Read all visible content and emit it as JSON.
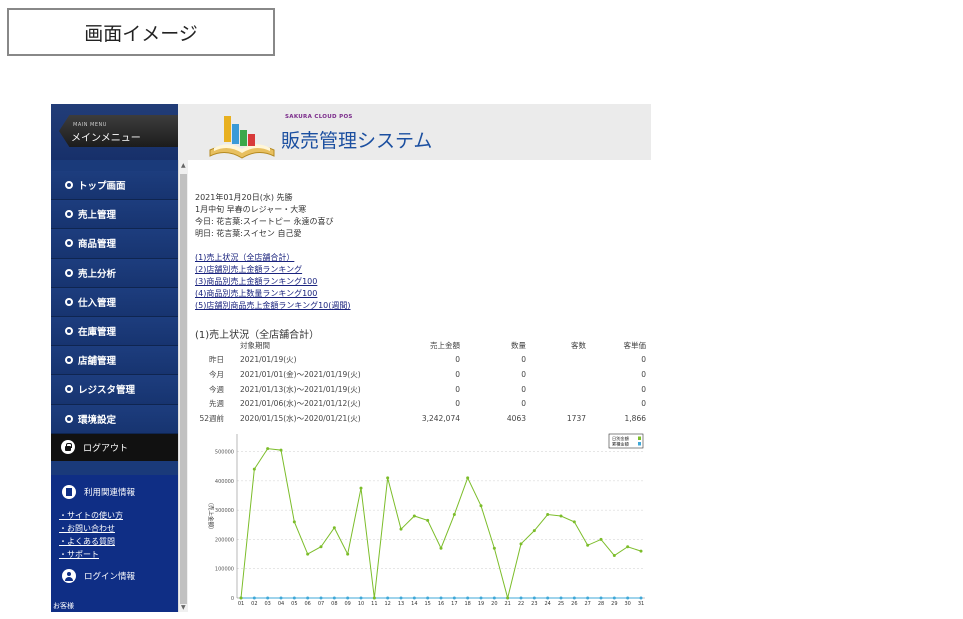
{
  "caption": "画面イメージ",
  "sidebar": {
    "mainmenu_small": "MAIN MENU",
    "mainmenu_title": "メインメニュー",
    "items": [
      "トップ画面",
      "売上管理",
      "商品管理",
      "売上分析",
      "仕入管理",
      "在庫管理",
      "店舗管理",
      "レジスタ管理",
      "環境設定"
    ],
    "logout": "ログアウト",
    "related_title": "利用関連情報",
    "related_links": [
      "サイトの使い方",
      "お問い合わせ",
      "よくある質問",
      "サポート"
    ],
    "login_title": "ログイン情報",
    "guest": "お客様"
  },
  "header": {
    "brand_small": "SAKURA CLOUD POS",
    "brand_title": "販売管理システム"
  },
  "info": {
    "date": "2021年01月20日(水) 先勝",
    "season": "1月中旬 早春のレジャー・大寒",
    "today_flower": "今日: 花言葉:スイートピー 永遠の喜び",
    "tomorrow_flower": "明日: 花言葉:スイセン 自己愛"
  },
  "links": [
    "(1)売上状況（全店舗合計）",
    "(2)店舗別売上金額ランキング",
    "(3)商品別売上金額ランキング100",
    "(4)商品別売上数量ランキング100",
    "(5)店舗別商品売上金額ランキング10(週間)"
  ],
  "section_title": "(1)売上状況（全店舗合計）",
  "table": {
    "headers": [
      "",
      "対象期間",
      "売上金額",
      "数量",
      "客数",
      "客単価"
    ],
    "rows": [
      [
        "昨日",
        "2021/01/19(火)",
        "0",
        "0",
        "",
        "0"
      ],
      [
        "今月",
        "2021/01/01(金)～2021/01/19(火)",
        "0",
        "0",
        "",
        "0"
      ],
      [
        "今週",
        "2021/01/13(水)～2021/01/19(火)",
        "0",
        "0",
        "",
        "0"
      ],
      [
        "先週",
        "2021/01/06(水)～2021/01/12(火)",
        "0",
        "0",
        "",
        "0"
      ],
      [
        "52週前",
        "2020/01/15(水)～2020/01/21(火)",
        "3,242,074",
        "4063",
        "1737",
        "1,866"
      ]
    ]
  },
  "chart_data": {
    "type": "line",
    "ylabel": "（売上金額）",
    "ylim": [
      0,
      560000
    ],
    "yticks": [
      0,
      100000,
      200000,
      300000,
      400000,
      500000
    ],
    "categories": [
      "01",
      "02",
      "03",
      "04",
      "05",
      "06",
      "07",
      "08",
      "09",
      "10",
      "11",
      "12",
      "13",
      "14",
      "15",
      "16",
      "17",
      "18",
      "19",
      "20",
      "21",
      "22",
      "23",
      "24",
      "25",
      "26",
      "27",
      "28",
      "29",
      "30",
      "31"
    ],
    "legend": [
      "日別金額",
      "累積金額"
    ],
    "grid": true,
    "series": [
      {
        "name": "日別金額",
        "color": "#7cbd2a",
        "values": [
          0,
          440000,
          510000,
          505000,
          260000,
          150000,
          175000,
          240000,
          150000,
          375000,
          0,
          410000,
          235000,
          280000,
          265000,
          170000,
          285000,
          410000,
          315000,
          170000,
          0,
          185000,
          230000,
          285000,
          280000,
          260000,
          180000,
          200000,
          145000,
          175000,
          160000
        ]
      },
      {
        "name": "累積金額",
        "color": "#3fa8d8",
        "values": [
          0,
          0,
          0,
          0,
          0,
          0,
          0,
          0,
          0,
          0,
          0,
          0,
          0,
          0,
          0,
          0,
          0,
          0,
          0,
          0,
          0,
          0,
          0,
          0,
          0,
          0,
          0,
          0,
          0,
          0,
          0
        ]
      }
    ]
  }
}
